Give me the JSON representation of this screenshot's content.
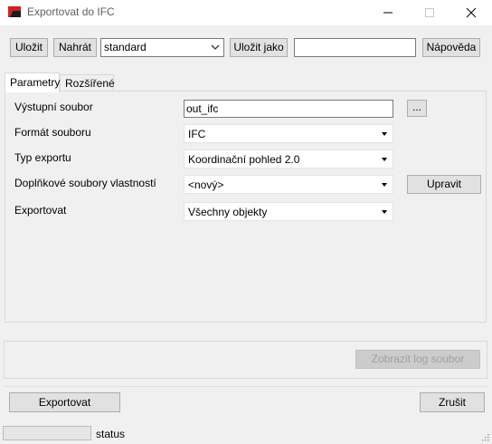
{
  "window": {
    "title": "Exportovat do IFC",
    "minimize_icon": "minimize-icon",
    "maximize_icon": "maximize-icon",
    "close_icon": "close-icon"
  },
  "toolbar": {
    "save_label": "Uložit",
    "load_label": "Nahrát",
    "setup_value": "standard",
    "save_as_label": "Uložit jako",
    "save_as_name": "",
    "help_label": "Nápověda"
  },
  "tabs": [
    {
      "label": "Parametry",
      "active": true
    },
    {
      "label": "Rozšířené",
      "active": false
    }
  ],
  "params": {
    "output_file_label": "Výstupní soubor",
    "output_file_value": "out_ifc",
    "browse_label": "...",
    "file_format_label": "Formát souboru",
    "file_format_value": "IFC",
    "export_type_label": "Typ exportu",
    "export_type_value": "Koordinační pohled 2.0",
    "property_sets_label": "Doplňkové soubory vlastností",
    "property_sets_value": "<nový>",
    "edit_label": "Upravit",
    "export_label": "Exportovat",
    "export_value": "Všechny objekty"
  },
  "log": {
    "show_log_label": "Zobrazit log soubor",
    "show_log_enabled": false
  },
  "footer": {
    "export_button": "Exportovat",
    "cancel_button": "Zrušit"
  },
  "status": {
    "progress": 0,
    "text": "status"
  }
}
